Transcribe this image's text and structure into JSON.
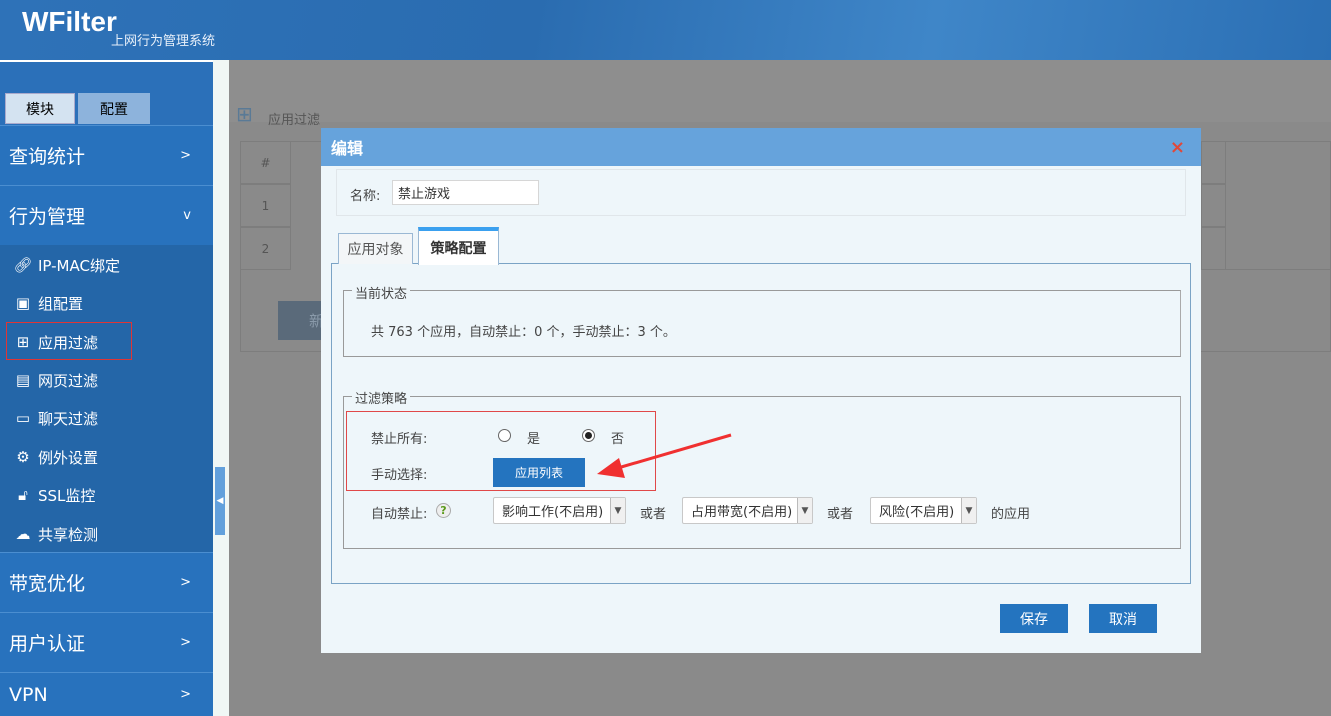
{
  "header": {
    "logo": "WFilter",
    "subtitle": "上网行为管理系统"
  },
  "sidebar": {
    "tabs": [
      {
        "label": "模块"
      },
      {
        "label": "配置"
      }
    ],
    "menus": [
      {
        "label": "查询统计",
        "chev": ">"
      },
      {
        "label": "行为管理",
        "chev": "v"
      },
      {
        "label": "带宽优化",
        "chev": ">"
      },
      {
        "label": "用户认证",
        "chev": ">"
      },
      {
        "label": "VPN",
        "chev": ">"
      }
    ],
    "items": [
      {
        "label": "IP-MAC绑定",
        "icon": "link-icon"
      },
      {
        "label": "组配置",
        "icon": "id-card-icon"
      },
      {
        "label": "应用过滤",
        "icon": "grid-icon",
        "active": true
      },
      {
        "label": "网页过滤",
        "icon": "page-icon"
      },
      {
        "label": "聊天过滤",
        "icon": "chat-icon"
      },
      {
        "label": "例外设置",
        "icon": "gear-icon"
      },
      {
        "label": "SSL监控",
        "icon": "lock-icon"
      },
      {
        "label": "共享检测",
        "icon": "cloud-icon"
      }
    ]
  },
  "background": {
    "breadcrumb": "应用过滤",
    "table_header": "#",
    "rows": [
      "1",
      "2"
    ],
    "new_button": "新"
  },
  "modal": {
    "title": "编辑",
    "close": "×",
    "name_label": "名称:",
    "name_value": "禁止游戏",
    "tabs": [
      {
        "label": "应用对象"
      },
      {
        "label": "策略配置",
        "active": true
      }
    ],
    "status": {
      "legend": "当前状态",
      "text": "共 763 个应用，自动禁止：0 个，手动禁止：3 个。"
    },
    "policy": {
      "legend": "过滤策略",
      "block_all_label": "禁止所有:",
      "yes": "是",
      "no": "否",
      "block_all_value": "否",
      "manual_label": "手动选择:",
      "app_list_button": "应用列表",
      "auto_label": "自动禁止:",
      "help": "?",
      "select1": "影响工作(不启用)",
      "or1": "或者",
      "select2": "占用带宽(不启用)",
      "or2": "或者",
      "select3": "风险(不启用)",
      "suffix": "的应用"
    },
    "save": "保存",
    "cancel": "取消"
  },
  "colors": {
    "primary": "#2474bf",
    "header": "#66a3dc",
    "highlight": "#e0483a"
  }
}
